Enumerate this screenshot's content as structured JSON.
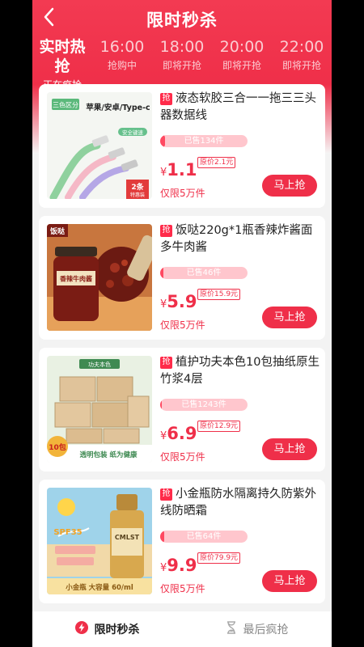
{
  "header": {
    "title": "限时秒杀",
    "back_icon": "chevron-left-icon"
  },
  "sessions": [
    {
      "time": "实时热抢",
      "status": "正在疯抢",
      "active": true
    },
    {
      "time": "16:00",
      "status": "抢购中",
      "active": false
    },
    {
      "time": "18:00",
      "status": "即将开抢",
      "active": false
    },
    {
      "time": "20:00",
      "status": "即将开抢",
      "active": false
    },
    {
      "time": "22:00",
      "status": "即将开抢",
      "active": false
    }
  ],
  "products": [
    {
      "tag": "抢",
      "name": "液态软胶三合一一拖三三头器数据线",
      "sold": "已售134件",
      "sold_fraction": 0.06,
      "currency": "¥",
      "price": "1.1",
      "original": "原价2.1元",
      "limit": "仅限5万件",
      "buy": "马上抢",
      "thumb_text": {
        "corner": "三色区分",
        "title": "苹果/安卓/Type-c",
        "sub": "安全键速",
        "badge1": "2条",
        "badge2": "特惠装"
      }
    },
    {
      "tag": "抢",
      "name": "饭哒220g*1瓶香辣炸酱面多牛肉酱",
      "sold": "已售46件",
      "sold_fraction": 0.04,
      "currency": "¥",
      "price": "5.9",
      "original": "原价15.9元",
      "limit": "仅限5万件",
      "buy": "马上抢",
      "thumb_text": {
        "corner": "饭哒",
        "jar": "香辣牛肉酱"
      }
    },
    {
      "tag": "抢",
      "name": "植护功夫本色10包抽纸原生竹浆4层",
      "sold": "已售1243件",
      "sold_fraction": 0.02,
      "currency": "¥",
      "price": "6.9",
      "original": "原价12.9元",
      "limit": "仅限5万件",
      "buy": "马上抢",
      "thumb_text": {
        "top": "功夫本色",
        "badge": "10包",
        "strip": "透明包装 纸为健康"
      }
    },
    {
      "tag": "抢",
      "name": "小金瓶防水隔离持久防紫外线防晒霜",
      "sold": "已售64件",
      "sold_fraction": 0.05,
      "currency": "¥",
      "price": "9.9",
      "original": "原价79.9元",
      "limit": "仅限5万件",
      "buy": "马上抢",
      "thumb_text": {
        "spf": "SPF35",
        "brand": "CMLST",
        "strip": "小金瓶 大容量 60/ml"
      }
    }
  ],
  "bottom_tabs": [
    {
      "label": "限时秒杀",
      "icon": "flash-icon",
      "active": true
    },
    {
      "label": "最后疯抢",
      "icon": "hourglass-icon",
      "active": false
    }
  ],
  "colors": {
    "primary": "#ef2f49",
    "sold_track": "#ffc6cd",
    "sold_fill": "#ff4961"
  }
}
